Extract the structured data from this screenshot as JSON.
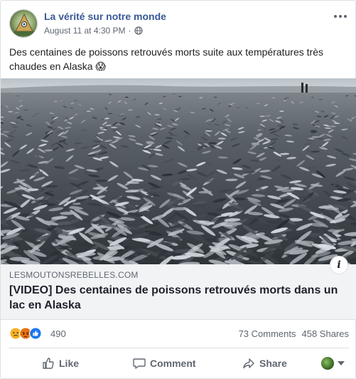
{
  "post": {
    "page_name": "La vérité sur notre monde",
    "timestamp": "August 11 at 4:30 PM",
    "separator": "·",
    "privacy_icon": "globe-icon",
    "more_icon": "ellipsis-icon",
    "text": "Des centaines de poissons retrouvés morts suite aux températures très chaudes en Alaska 😱"
  },
  "link": {
    "domain": "LESMOUTONSREBELLES.COM",
    "title": "[VIDEO] Des centaines de poissons retrouvés morts dans un lac en Alaska",
    "info_label": "i"
  },
  "reactions": {
    "icons": [
      "sad-icon",
      "angry-icon",
      "like-icon"
    ],
    "total": "490",
    "comments": "73 Comments",
    "shares": "458 Shares"
  },
  "actions": {
    "like": "Like",
    "comment": "Comment",
    "share": "Share"
  },
  "colors": {
    "page_name": "#385898",
    "secondary_text": "#606770",
    "link_card_bg": "#f2f3f5",
    "like_blue": "#1877f2",
    "sad_yellow": "#f7b125",
    "angry_orange": "#e9710f"
  }
}
